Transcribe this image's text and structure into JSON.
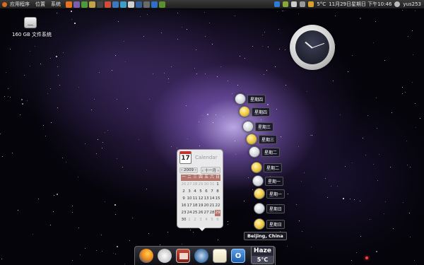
{
  "top_panel": {
    "menus": [
      "应用程序",
      "位置",
      "系统"
    ],
    "launchers": [
      {
        "icon": "firefox-icon",
        "color": "#e8731c"
      },
      {
        "icon": "pidgin-icon",
        "color": "#7a5fb0"
      },
      {
        "icon": "network-icon",
        "color": "#4c9a3c"
      },
      {
        "icon": "settings-icon",
        "color": "#c2a24a"
      },
      {
        "icon": "terminal-icon",
        "color": "#444444"
      },
      {
        "icon": "image-icon",
        "color": "#d34b3b"
      },
      {
        "icon": "music-icon",
        "color": "#3a78c4"
      },
      {
        "icon": "globe-icon",
        "color": "#3aa0c9"
      },
      {
        "icon": "document-icon",
        "color": "#cfcfcf"
      },
      {
        "icon": "monitor-icon",
        "color": "#2e5f9a"
      },
      {
        "icon": "window-icon",
        "color": "#6a6a6a"
      },
      {
        "icon": "mail-icon",
        "color": "#2f6fcc"
      },
      {
        "icon": "leaf-icon",
        "color": "#5c8f2d"
      }
    ],
    "tray": {
      "temperature": "5°C",
      "datetime": "11月29日星期日 下午10:46",
      "username": "yus253"
    }
  },
  "desktop": {
    "drive_label": "160 GB 文件系统"
  },
  "calendar": {
    "icon_day": "17",
    "title": "Calendar",
    "year": "2009",
    "month": "十一月",
    "weekdays": [
      "一",
      "二",
      "三",
      "四",
      "五",
      "六",
      "日"
    ],
    "days": [
      {
        "n": "26",
        "dim": true
      },
      {
        "n": "27",
        "dim": true
      },
      {
        "n": "28",
        "dim": true
      },
      {
        "n": "29",
        "dim": true
      },
      {
        "n": "30",
        "dim": true
      },
      {
        "n": "31",
        "dim": true
      },
      {
        "n": "1"
      },
      {
        "n": "2"
      },
      {
        "n": "3"
      },
      {
        "n": "4"
      },
      {
        "n": "5"
      },
      {
        "n": "6"
      },
      {
        "n": "7"
      },
      {
        "n": "8"
      },
      {
        "n": "9"
      },
      {
        "n": "10"
      },
      {
        "n": "11"
      },
      {
        "n": "12"
      },
      {
        "n": "13"
      },
      {
        "n": "14"
      },
      {
        "n": "15"
      },
      {
        "n": "16"
      },
      {
        "n": "17"
      },
      {
        "n": "18"
      },
      {
        "n": "19"
      },
      {
        "n": "20"
      },
      {
        "n": "21"
      },
      {
        "n": "22"
      },
      {
        "n": "23"
      },
      {
        "n": "24"
      },
      {
        "n": "25"
      },
      {
        "n": "26"
      },
      {
        "n": "27"
      },
      {
        "n": "28"
      },
      {
        "n": "29",
        "today": true
      },
      {
        "n": "30"
      },
      {
        "n": "1",
        "dim": true
      },
      {
        "n": "2",
        "dim": true
      },
      {
        "n": "3",
        "dim": true
      },
      {
        "n": "4",
        "dim": true
      },
      {
        "n": "5",
        "dim": true
      },
      {
        "n": "6",
        "dim": true
      }
    ]
  },
  "weather": {
    "forecast": [
      {
        "day": "星期四",
        "icon": "cloudy-icon"
      },
      {
        "day": "星期四",
        "icon": "partly-sunny-icon"
      },
      {
        "day": "星期三",
        "icon": "cloudy-icon"
      },
      {
        "day": "星期三",
        "icon": "partly-sunny-icon"
      },
      {
        "day": "星期二",
        "icon": "cloudy-icon"
      },
      {
        "day": "星期二",
        "icon": "partly-sunny-icon"
      },
      {
        "day": "星期一",
        "icon": "cloudy-icon"
      },
      {
        "day": "星期一",
        "icon": "partly-sunny-icon"
      },
      {
        "day": "星期日",
        "icon": "cloudy-icon"
      },
      {
        "day": "星期日",
        "icon": "partly-sunny-icon"
      }
    ],
    "city": "Beijing, China",
    "condition": "Haze",
    "temperature": "5°C"
  },
  "dock": {
    "items": [
      {
        "name": "firefox-icon"
      },
      {
        "name": "clock-icon"
      },
      {
        "name": "presentation-icon"
      },
      {
        "name": "chat-icon"
      },
      {
        "name": "document-icon"
      },
      {
        "name": "outlook-icon",
        "glyph": "O"
      }
    ]
  }
}
